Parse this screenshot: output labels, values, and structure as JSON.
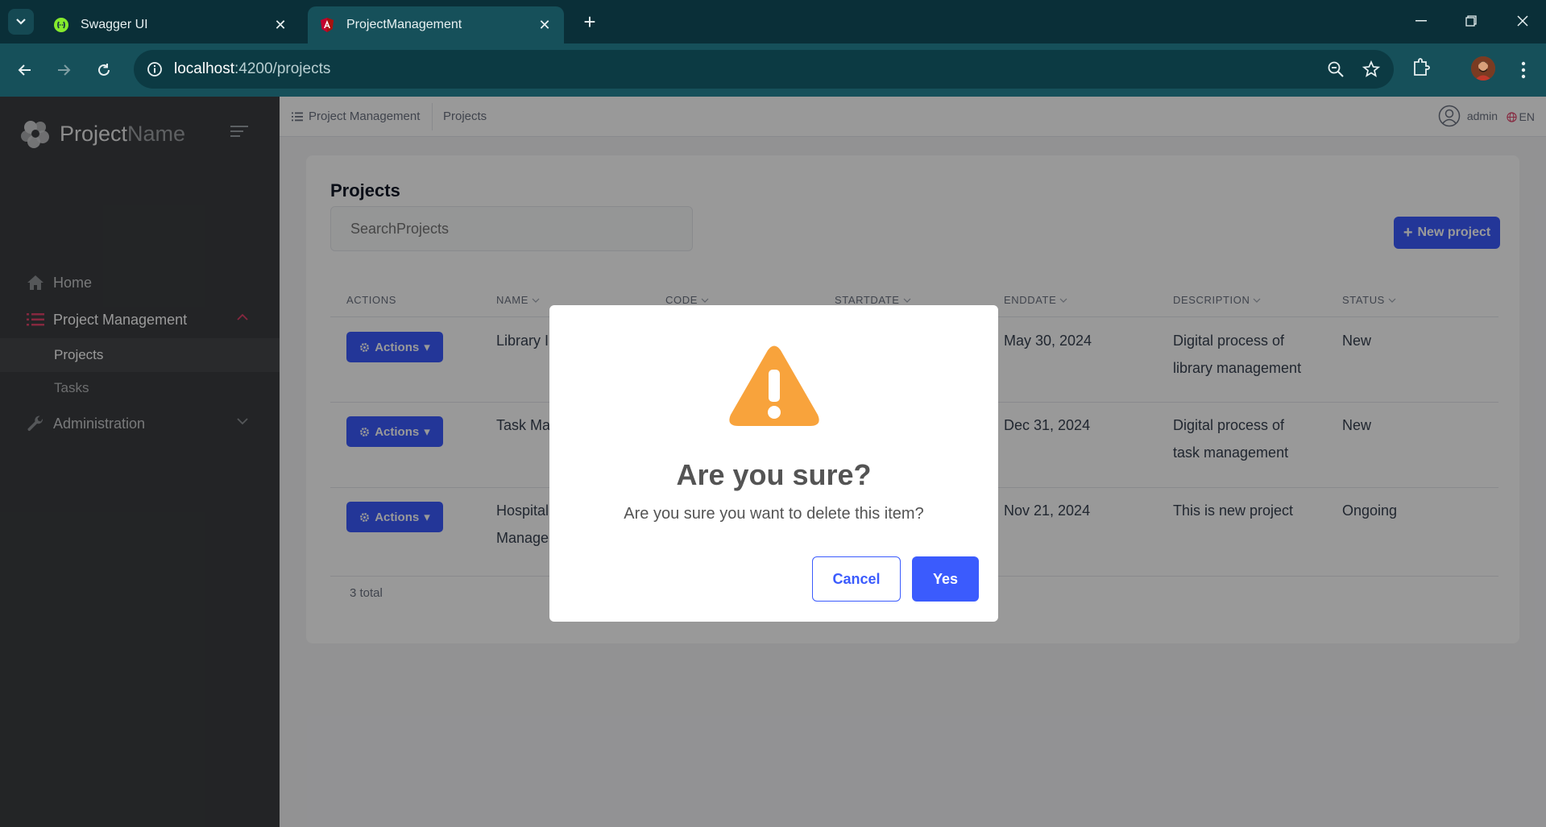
{
  "browser": {
    "tabs": [
      {
        "title": "Swagger UI",
        "close": "✕"
      },
      {
        "title": "ProjectManagement",
        "close": "✕"
      }
    ],
    "new_tab": "+",
    "url_host": "localhost",
    "url_path": ":4200/projects"
  },
  "sidebar": {
    "brand_bold": "Project",
    "brand_light": "Name",
    "items": [
      {
        "label": "Home",
        "icon": "home-icon"
      },
      {
        "label": "Project Management",
        "icon": "list-icon"
      },
      {
        "label": "Administration",
        "icon": "wrench-icon"
      }
    ],
    "subitems": [
      {
        "label": "Projects"
      },
      {
        "label": "Tasks"
      }
    ]
  },
  "topbar": {
    "breadcrumb": [
      "Project Management",
      "Projects"
    ],
    "user": "admin",
    "lang": "EN"
  },
  "page": {
    "title": "Projects",
    "search_placeholder": "SearchProjects",
    "new_button": "New project",
    "columns": [
      "ACTIONS",
      "NAME",
      "CODE",
      "STARTDATE",
      "ENDDATE",
      "DESCRIPTION",
      "STATUS"
    ],
    "rows": [
      {
        "action": "Actions",
        "name": "Library I",
        "enddate": "May 30, 2024",
        "desc1": "Digital process of",
        "desc2": "library management",
        "status": "New"
      },
      {
        "action": "Actions",
        "name": "Task Ma",
        "enddate": "Dec 31, 2024",
        "desc1": "Digital process of",
        "desc2": "task management",
        "status": "New"
      },
      {
        "action": "Actions",
        "name": "Hospital",
        "name2": "Manage",
        "enddate": "Nov 21, 2024",
        "desc1": "This is new project",
        "desc2": "",
        "status": "Ongoing"
      }
    ],
    "total": "3 total"
  },
  "modal": {
    "title": "Are you sure?",
    "text": "Are you sure you want to delete this item?",
    "cancel": "Cancel",
    "confirm": "Yes"
  },
  "colors": {
    "primary": "#3b5bfd",
    "warning": "#f8a33c",
    "sidebar": "#3b3d40",
    "accent_red": "#e0446a"
  }
}
